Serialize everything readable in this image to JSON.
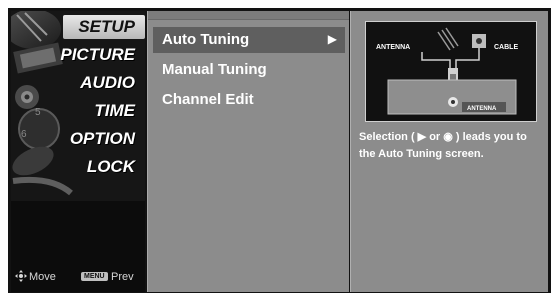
{
  "menu": {
    "items": [
      {
        "label": "SETUP",
        "active": true
      },
      {
        "label": "PICTURE",
        "active": false
      },
      {
        "label": "AUDIO",
        "active": false
      },
      {
        "label": "TIME",
        "active": false
      },
      {
        "label": "OPTION",
        "active": false
      },
      {
        "label": "LOCK",
        "active": false
      }
    ]
  },
  "footer": {
    "move_label": "Move",
    "menu_button_label": "MENU",
    "prev_label": "Prev"
  },
  "submenu": {
    "items": [
      {
        "label": "Auto Tuning",
        "selected": true,
        "arrow": "▶"
      },
      {
        "label": "Manual Tuning",
        "selected": false
      },
      {
        "label": "Channel Edit",
        "selected": false
      }
    ]
  },
  "diagram": {
    "antenna_label": "ANTENNA",
    "cable_label": "CABLE",
    "port_label": "ANTENNA"
  },
  "description": "Selection ( ▶ or ◉ ) leads you to the Auto Tuning screen.",
  "colors": {
    "panel_gray": "#8c8c8c",
    "selection_gray": "#5f5f5f",
    "frame_dark": "#121212"
  }
}
